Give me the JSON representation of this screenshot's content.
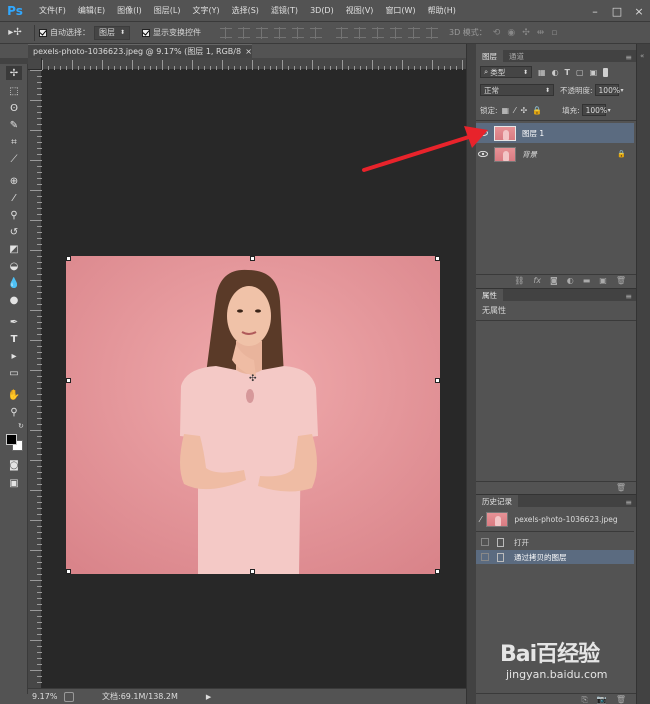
{
  "menu": {
    "logo": "Ps",
    "items": [
      "文件(F)",
      "编辑(E)",
      "图像(I)",
      "图层(L)",
      "文字(Y)",
      "选择(S)",
      "滤镜(T)",
      "3D(D)",
      "视图(V)",
      "窗口(W)",
      "帮助(H)"
    ],
    "window_controls": [
      "–",
      "□",
      "×"
    ]
  },
  "options": {
    "auto_select_label": "自动选择：",
    "auto_select_value": "图层",
    "show_transform_label": "显示变换控件",
    "mode3d_label": "3D 模式："
  },
  "document": {
    "tab_title": "pexels-photo-1036623.jpeg @ 9.17% (图层 1, RGB/8) *",
    "close": "×"
  },
  "status": {
    "zoom": "9.17%",
    "doc_info": "文档:69.1M/138.2M"
  },
  "layers_panel": {
    "tabs": [
      "图层",
      "通道"
    ],
    "filter_kind": "类型",
    "blend_mode": "正常",
    "opacity_label": "不透明度:",
    "opacity_value": "100%",
    "lock_label": "锁定:",
    "fill_label": "填充:",
    "fill_value": "100%",
    "layers": [
      {
        "name": "图层 1",
        "selected": true
      },
      {
        "name": "背景",
        "locked": true
      }
    ]
  },
  "properties_panel": {
    "tab": "属性",
    "content": "无属性"
  },
  "history_panel": {
    "tab": "历史记录",
    "snapshot": "pexels-photo-1036623.jpeg",
    "steps": [
      "打开",
      "通过拷贝的图层"
    ]
  },
  "watermark": {
    "brand_line": "Bai百经验",
    "url": "jingyan.baidu.com"
  },
  "colors": {
    "accent_blue": "#31a8ff",
    "selection": "#5b6b80",
    "arrow": "#e8232b",
    "canvas_pink": "#e8999c"
  }
}
